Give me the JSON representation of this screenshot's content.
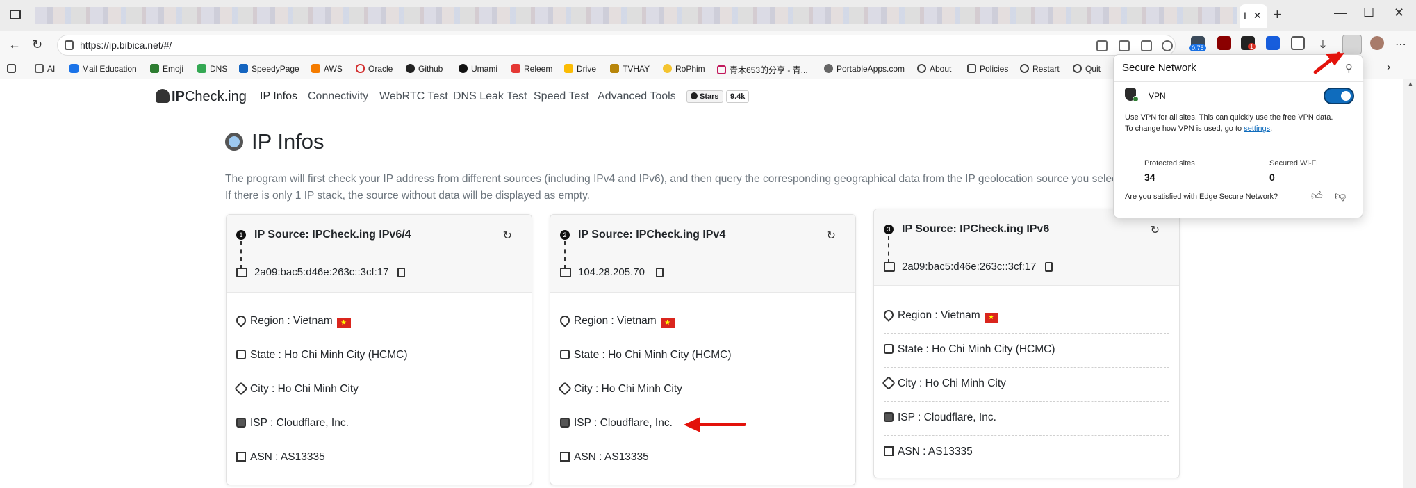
{
  "browser": {
    "tab_close": "✕",
    "tab_label": "I",
    "new_tab": "+",
    "url": "https://ip.bibica.net/#/",
    "window_controls": [
      "—",
      "☐",
      "✕"
    ],
    "ext_badge_1": "0.75",
    "ext_badge_2": "1"
  },
  "bookmarks": [
    {
      "label": "AI",
      "icon": "folder-icon"
    },
    {
      "label": "Mail Education",
      "icon": "mail-icon"
    },
    {
      "label": "Emoji",
      "icon": "emoji-icon"
    },
    {
      "label": "DNS",
      "icon": "shield-icon"
    },
    {
      "label": "SpeedyPage",
      "icon": "grid-icon"
    },
    {
      "label": "AWS",
      "icon": "aws-icon"
    },
    {
      "label": "Oracle",
      "icon": "oracle-icon"
    },
    {
      "label": "Github",
      "icon": "github-icon"
    },
    {
      "label": "Umami",
      "icon": "umami-icon"
    },
    {
      "label": "Releem",
      "icon": "releem-icon"
    },
    {
      "label": "Drive",
      "icon": "drive-icon"
    },
    {
      "label": "TVHAY",
      "icon": "tv-icon"
    },
    {
      "label": "RoPhim",
      "icon": "rophim-icon"
    },
    {
      "label": "青木653的分享 - 青...",
      "icon": "blog-icon"
    },
    {
      "label": "PortableApps.com",
      "icon": "portableapps-icon"
    },
    {
      "label": "About",
      "icon": "globe-icon"
    },
    {
      "label": "Policies",
      "icon": "bag-icon"
    },
    {
      "label": "Restart",
      "icon": "globe-icon"
    },
    {
      "label": "Quit",
      "icon": "globe-icon"
    }
  ],
  "site": {
    "logo_bold": "IP",
    "logo_rest": "Check.ing",
    "nav": [
      "IP Infos",
      "Connectivity",
      "WebRTC Test",
      "DNS Leak Test",
      "Speed Test",
      "Advanced Tools"
    ],
    "stars_label": "Stars",
    "stars_count": "9.4k"
  },
  "page": {
    "title": "IP Infos",
    "description": "The program will first check your IP address from different sources (including IPv4 and IPv6), and then query the corresponding geographical data from the IP geolocation source you select. If there is only 1 IP stack, the source without data will be displayed as empty."
  },
  "cards": [
    {
      "num": "1",
      "title": "IP Source: IPCheck.ing IPv6/4",
      "ip": "2a09:bac5:d46e:263c::3cf:17",
      "region": "Region : Vietnam",
      "state": "State : Ho Chi Minh City (HCMC)",
      "city": "City : Ho Chi Minh City",
      "isp": "ISP : Cloudflare, Inc.",
      "asn": "ASN : AS13335"
    },
    {
      "num": "2",
      "title": "IP Source: IPCheck.ing IPv4",
      "ip": "104.28.205.70",
      "region": "Region : Vietnam",
      "state": "State : Ho Chi Minh City (HCMC)",
      "city": "City : Ho Chi Minh City",
      "isp": "ISP : Cloudflare, Inc.",
      "asn": "ASN : AS13335"
    },
    {
      "num": "3",
      "title": "IP Source: IPCheck.ing IPv6",
      "ip": "2a09:bac5:d46e:263c::3cf:17",
      "region": "Region : Vietnam",
      "state": "State : Ho Chi Minh City (HCMC)",
      "city": "City : Ho Chi Minh City",
      "isp": "ISP : Cloudflare, Inc.",
      "asn": "ASN : AS13335"
    }
  ],
  "popup": {
    "title": "Secure Network",
    "vpn_label": "VPN",
    "vpn_enabled": true,
    "desc_1": "Use VPN for all sites. This can quickly use the free VPN data.",
    "desc_2": "To change how VPN is used, go to",
    "settings_link": "settings",
    "desc_end": ".",
    "protected_label": "Protected sites",
    "protected_value": "34",
    "wifi_label": "Secured Wi-Fi",
    "wifi_value": "0",
    "satisfied": "Are you satisfied with Edge Secure Network?"
  },
  "colors": {
    "annotation_arrow": "#e3120b",
    "toggle_on": "#0f6cbd",
    "flag_red": "#da251d"
  }
}
